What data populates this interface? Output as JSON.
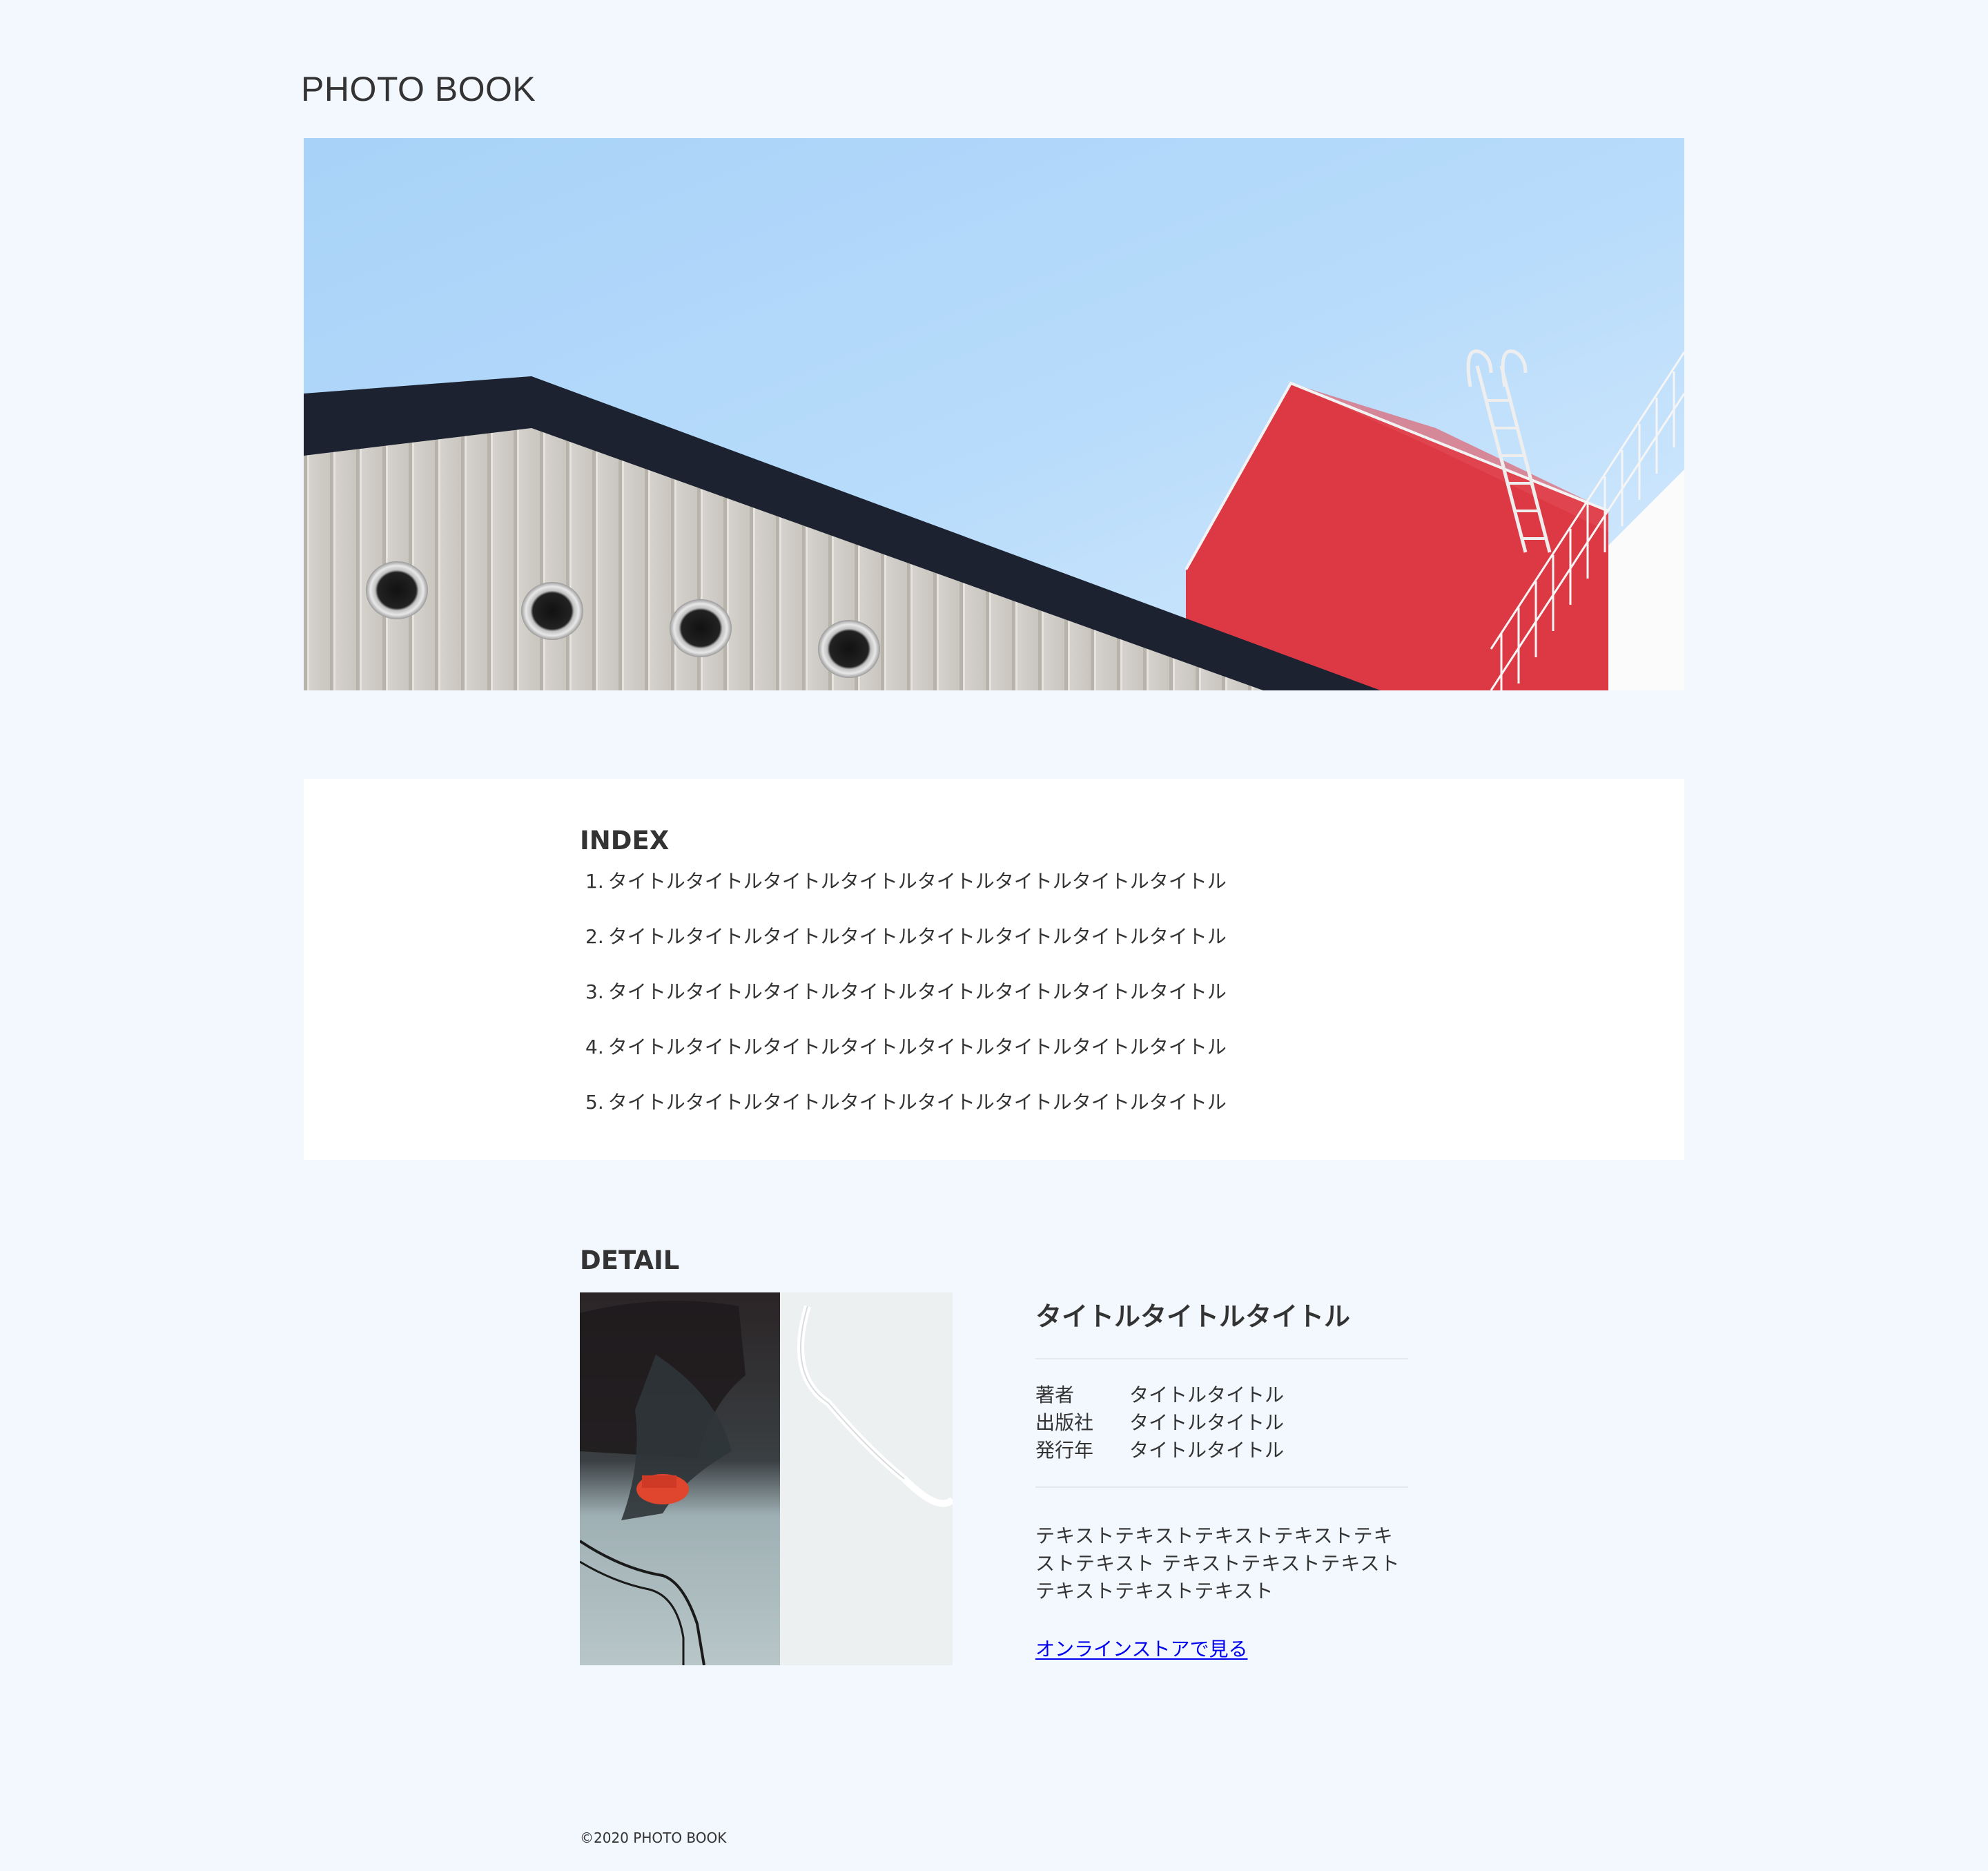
{
  "site": {
    "title": "PHOTO BOOK"
  },
  "index": {
    "heading": "INDEX",
    "items": [
      {
        "num": "1.",
        "label": "タイトルタイトルタイトルタイトルタイトルタイトルタイトルタイトル"
      },
      {
        "num": "2.",
        "label": "タイトルタイトルタイトルタイトルタイトルタイトルタイトルタイトル"
      },
      {
        "num": "3.",
        "label": "タイトルタイトルタイトルタイトルタイトルタイトルタイトルタイトル"
      },
      {
        "num": "4.",
        "label": "タイトルタイトルタイトルタイトルタイトルタイトルタイトルタイトル"
      },
      {
        "num": "5.",
        "label": "タイトルタイトルタイトルタイトルタイトルタイトルタイトルタイトル"
      }
    ]
  },
  "detail": {
    "heading": "DETAIL",
    "book_title": "タイトルタイトルタイトル",
    "meta": [
      {
        "key": "著者",
        "value": "タイトルタイトル"
      },
      {
        "key": "出版社",
        "value": "タイトルタイトル"
      },
      {
        "key": "発行年",
        "value": "タイトルタイトル"
      }
    ],
    "description": "テキストテキストテキストテキストテキストテキスト テキストテキストテキストテキストテキストテキスト",
    "store_link": "オンラインストアで見る"
  },
  "footer": {
    "copyright": "©2020 PHOTO BOOK"
  },
  "colors": {
    "background": "#f3f8fe",
    "panel": "#ffffff",
    "text": "#333333",
    "link": "#0000ee",
    "sky": "#b3dbfb",
    "tower_red": "#dc3945",
    "roof_dark": "#1c2230"
  }
}
